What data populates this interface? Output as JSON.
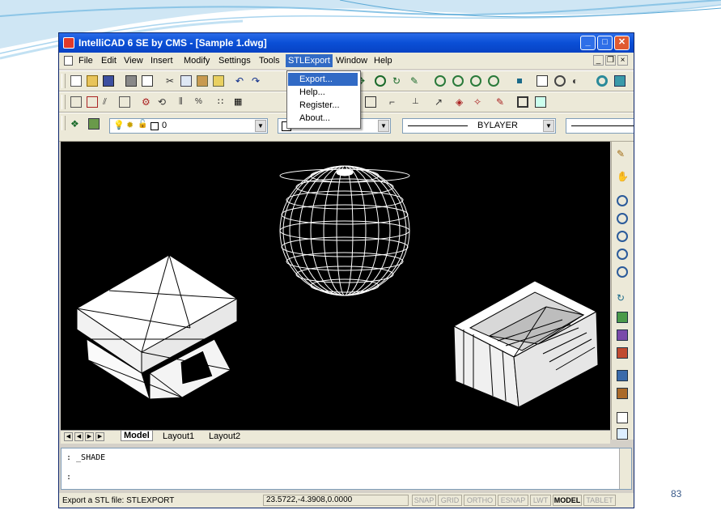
{
  "window": {
    "title": "IntelliCAD 6 SE by CMS - [Sample 1.dwg]",
    "min_glyph": "_",
    "max_glyph": "□",
    "close_glyph": "✕"
  },
  "menubar": {
    "items": [
      "File",
      "Edit",
      "View",
      "Insert",
      "Modify",
      "Settings",
      "Tools",
      "STLExport",
      "Window",
      "Help"
    ],
    "active": "STLExport",
    "mdi_min": "_",
    "mdi_restore": "❐",
    "mdi_close": "×"
  },
  "stlexport_menu": {
    "items": [
      "Export...",
      "Help...",
      "Register...",
      "About..."
    ],
    "highlighted": "Export..."
  },
  "properties_toolbar": {
    "layer_value": "0",
    "color_value": "BYLAYER",
    "linetype_value": "BYLAYER"
  },
  "layout_tabs": {
    "items": [
      "Model",
      "Layout1",
      "Layout2"
    ],
    "active": "Model"
  },
  "command_line": {
    "line1": ": _SHADE",
    "line2": ":"
  },
  "status_bar": {
    "message": "Export a STL file: STLEXPORT",
    "coordinates": "23.5722,-4.3908,0.0000",
    "toggles": [
      "SNAP",
      "GRID",
      "ORTHO",
      "ESNAP",
      "LWT",
      "MODEL",
      "TABLET"
    ],
    "active_toggle": "MODEL"
  },
  "slide": {
    "page_number": "83"
  },
  "colors": {
    "title_bar": "#0a4fd6",
    "menu_highlight": "#316ac5",
    "canvas": "#000000",
    "slide_accent": "#5aa9d6"
  }
}
